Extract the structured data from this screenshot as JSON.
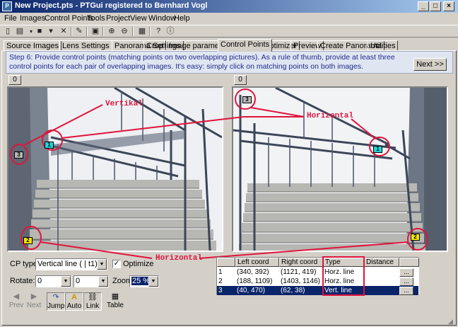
{
  "window": {
    "title": "New Project.pts - PTGui registered to Bernhard Vogl"
  },
  "menu": [
    "File",
    "Images",
    "Control Points",
    "Tools",
    "Project",
    "View",
    "Window",
    "Help"
  ],
  "tabs": [
    "Source Images",
    "Lens Settings",
    "Panorama Settings",
    "Crop",
    "Image parameters",
    "Control Points",
    "Optimizer",
    "Preview",
    "Create Panorama",
    "Utilities"
  ],
  "active_tab": "Control Points",
  "step": {
    "text": "Step 6: Provide control points (matching points on two overlapping pictures). As a rule of thumb, provide at least three control points for each pair of overlapping images. It's easy: simply click on matching points on both images.",
    "next_label": "Next >>"
  },
  "left_image": {
    "tab": "0"
  },
  "right_image": {
    "tab": "0"
  },
  "annotations": {
    "vertikal": "Vertikal",
    "horizontal_top": "Horizontal",
    "horizontal_bottom": "Horizontal"
  },
  "markers": {
    "left": [
      "3",
      "1",
      "2"
    ],
    "right": [
      "3",
      "1",
      "2"
    ]
  },
  "controls": {
    "cp_type_label": "CP type:",
    "cp_type_value": "Vertical line    ( | t1)",
    "optimize_label": "Optimize",
    "optimize_checked": true,
    "rotate_label": "Rotate:",
    "rotate_left": "0",
    "rotate_right": "0",
    "zoom_label": "Zoom:",
    "zoom_value": "25 %"
  },
  "tools": {
    "prev": "Prev",
    "next": "Next",
    "jump": "Jump",
    "auto": "Auto",
    "link": "Link",
    "table": "Table"
  },
  "table": {
    "headers": [
      "",
      "Left coord",
      "Right coord",
      "Type",
      "Distance"
    ],
    "rows": [
      {
        "n": "1",
        "left": "(340, 392)",
        "right": "(1121, 419)",
        "type": "Horz. line",
        "distance": ""
      },
      {
        "n": "2",
        "left": "(188, 1109)",
        "right": "(1403, 1146)",
        "type": "Horz. line",
        "distance": ""
      },
      {
        "n": "3",
        "left": "(40, 470)",
        "right": "(62, 38)",
        "type": "Vert. line",
        "distance": ""
      }
    ],
    "selected_row": 3,
    "dots_label": "..."
  },
  "colors": {
    "annotation": "#e0143c",
    "selection": "#0a246a",
    "marker_cyan": "#22d4d4",
    "marker_yellow": "#f5e600",
    "marker_gray": "#b8b8b8"
  }
}
